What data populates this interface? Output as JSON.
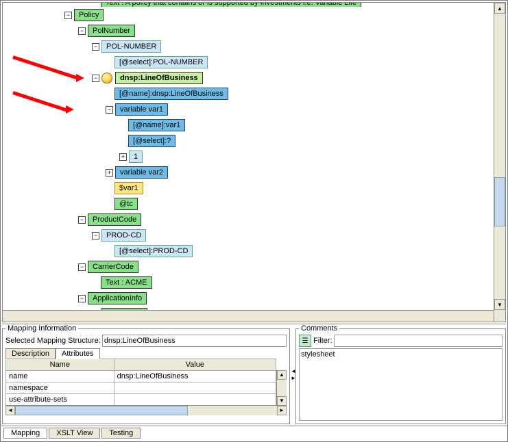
{
  "tree": {
    "nodes": [
      {
        "indent": 0,
        "color": "green",
        "label": "Text : A policy that contains or is supported by Investments i.e. Variable Life",
        "clipped": true
      },
      {
        "indent": 0,
        "color": "green",
        "toggle": "-",
        "label": "Policy"
      },
      {
        "indent": 1,
        "color": "green",
        "toggle": "-",
        "label": "PolNumber"
      },
      {
        "indent": 2,
        "color": "lblue",
        "toggle": "-",
        "label": "POL-NUMBER"
      },
      {
        "indent": 3,
        "color": "lblue",
        "label": "[@select]:POL-NUMBER"
      },
      {
        "indent": 2,
        "color": "green-sel",
        "toggle": "-",
        "bulb": true,
        "label": "dnsp:LineOfBusiness",
        "arrow": 1
      },
      {
        "indent": 3,
        "color": "blue",
        "label": "[@name]:dnsp:LineOfBusiness"
      },
      {
        "indent": 3,
        "color": "blue",
        "toggle": "-",
        "label": "variable var1",
        "arrow": 2
      },
      {
        "indent": 4,
        "color": "blue",
        "label": "[@name]:var1"
      },
      {
        "indent": 4,
        "color": "blue",
        "label": "[@select]:?"
      },
      {
        "indent": 4,
        "color": "lblue",
        "toggle": "+",
        "label": "1"
      },
      {
        "indent": 3,
        "color": "blue",
        "toggle": "+",
        "label": "variable var2"
      },
      {
        "indent": 3,
        "color": "yellow",
        "label": "$var1"
      },
      {
        "indent": 3,
        "color": "green",
        "label": "@tc"
      },
      {
        "indent": 1,
        "color": "green",
        "toggle": "-",
        "label": "ProductCode"
      },
      {
        "indent": 2,
        "color": "lblue",
        "toggle": "-",
        "label": "PROD-CD"
      },
      {
        "indent": 3,
        "color": "lblue",
        "label": "[@select]:PROD-CD"
      },
      {
        "indent": 1,
        "color": "green",
        "toggle": "-",
        "label": "CarrierCode"
      },
      {
        "indent": 2,
        "color": "green",
        "label": "Text : ACME"
      },
      {
        "indent": 1,
        "color": "green",
        "toggle": "-",
        "label": "ApplicationInfo"
      },
      {
        "indent": 2,
        "color": "green",
        "toggle": "+",
        "label": "TrackingID"
      }
    ]
  },
  "mapping": {
    "legend": "Mapping Information",
    "structure_label": "Selected Mapping Structure:",
    "structure_value": "dnsp:LineOfBusiness",
    "tabs": {
      "description": "Description",
      "attributes": "Attributes"
    },
    "active_tab": "Attributes",
    "table": {
      "header_name": "Name",
      "header_value": "Value",
      "rows": [
        {
          "name": "name",
          "value": "dnsp:LineOfBusiness"
        },
        {
          "name": "namespace",
          "value": ""
        },
        {
          "name": "use-attribute-sets",
          "value": ""
        }
      ]
    }
  },
  "comments": {
    "legend": "Comments",
    "filter_label": "Filter:",
    "items": [
      "stylesheet"
    ]
  },
  "bottom_tabs": {
    "mapping": "Mapping",
    "xslt": "XSLT View",
    "testing": "Testing"
  }
}
